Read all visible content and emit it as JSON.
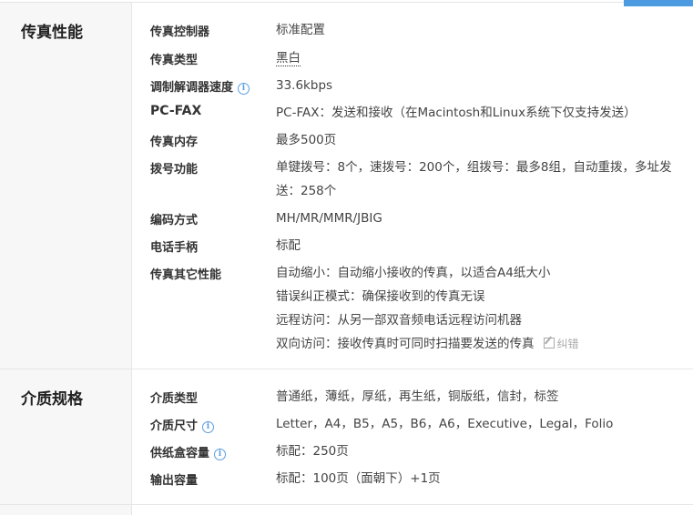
{
  "sections": [
    {
      "title": "传真性能",
      "rows": [
        {
          "label": "传真控制器",
          "value": "标准配置"
        },
        {
          "label": "传真类型",
          "value": "黑白"
        },
        {
          "label": "调制解调器速度",
          "value": "33.6kbps"
        },
        {
          "label": "PC-FAX",
          "value": "PC-FAX：发送和接收（在Macintosh和Linux系统下仅支持发送）"
        },
        {
          "label": "传真内存",
          "value": "最多500页"
        },
        {
          "label": "拨号功能",
          "value": "单键拨号：8个，速拨号：200个，组拨号：最多8组，自动重拨，多址发送：258个"
        },
        {
          "label": "编码方式",
          "value": "MH/MR/MMR/JBIG"
        },
        {
          "label": "电话手柄",
          "value": "标配"
        },
        {
          "label": "传真其它性能",
          "lines": [
            "自动缩小：自动缩小接收的传真，以适合A4纸大小",
            "错误纠正模式：确保接收到的传真无误",
            "远程访问：从另一部双音频电话远程访问机器",
            "双向访问：接收传真时可同时扫描要发送的传真"
          ]
        }
      ],
      "correction_label": "纠错"
    },
    {
      "title": "介质规格",
      "rows": [
        {
          "label": "介质类型",
          "value": "普通纸，薄纸，厚纸，再生纸，铜版纸，信封，标签"
        },
        {
          "label": "介质尺寸",
          "value": "Letter，A4，B5，A5，B6，A6，Executive，Legal，Folio"
        },
        {
          "label": "供纸盒容量",
          "value": "标配：250页"
        },
        {
          "label": "输出容量",
          "value": "标配：100页（面朝下）+1页"
        }
      ]
    }
  ],
  "info_icon": "i"
}
